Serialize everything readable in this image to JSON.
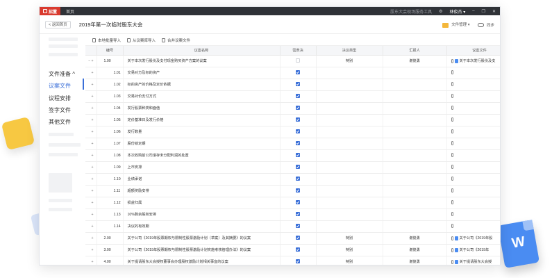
{
  "titlebar": {
    "logo": "招董",
    "home_tab": "首页",
    "system_name": "股东大会现场服务工具",
    "user_name": "林俊杰 ▾",
    "settings_glyph": "⚙",
    "minimize_glyph": "–",
    "restore_glyph": "❐",
    "close_glyph": "✕"
  },
  "header": {
    "back_label": "< 返回首页",
    "title": "2019年第一次临时股东大会",
    "file_manage": "文件管理",
    "file_manage_caret": "▾",
    "sync": "同步"
  },
  "sidebar": {
    "section": "文件准备",
    "section_caret": "^",
    "items": [
      "议案文件",
      "议程安排",
      "签字文件",
      "其他文件"
    ],
    "active_index": 0
  },
  "toolbar": {
    "import_local": "本地批量导入",
    "import_lib": "从议案库导入",
    "merge": "合并议案文件"
  },
  "table": {
    "headers": [
      "编号",
      "议案名称",
      "需表决",
      "决议类型",
      "汇报人",
      "议案文件"
    ],
    "rows": [
      {
        "exp": "− +",
        "num": "1.00",
        "name": "关于本次发行股份及支付现金购买资产方案的议案",
        "vote": false,
        "type": "特别",
        "reporter": "谢俊勇",
        "file": "关于本次发行股份及支",
        "sub": false,
        "clip": true,
        "doc": true
      },
      {
        "exp": "+",
        "num": "1.01",
        "name": "交易对方及标的资产",
        "vote": true,
        "type": "",
        "reporter": "",
        "file": "",
        "sub": true,
        "clip": true,
        "doc": false
      },
      {
        "exp": "+",
        "num": "1.02",
        "name": "标的资产的价格及定价依据",
        "vote": true,
        "type": "",
        "reporter": "",
        "file": "",
        "sub": true,
        "clip": true,
        "doc": false
      },
      {
        "exp": "+",
        "num": "1.03",
        "name": "交易对价支付方式",
        "vote": true,
        "type": "",
        "reporter": "",
        "file": "",
        "sub": true,
        "clip": true,
        "doc": false
      },
      {
        "exp": "+",
        "num": "1.04",
        "name": "发行股票种类和面值",
        "vote": true,
        "type": "",
        "reporter": "",
        "file": "",
        "sub": true,
        "clip": true,
        "doc": false
      },
      {
        "exp": "+",
        "num": "1.05",
        "name": "定价基准日及发行价格",
        "vote": true,
        "type": "",
        "reporter": "",
        "file": "",
        "sub": true,
        "clip": true,
        "doc": false
      },
      {
        "exp": "+",
        "num": "1.06",
        "name": "发行数量",
        "vote": true,
        "type": "",
        "reporter": "",
        "file": "",
        "sub": true,
        "clip": true,
        "doc": false
      },
      {
        "exp": "+",
        "num": "1.07",
        "name": "股份锁定期",
        "vote": true,
        "type": "",
        "reporter": "",
        "file": "",
        "sub": true,
        "clip": true,
        "doc": false
      },
      {
        "exp": "+",
        "num": "1.08",
        "name": "本次收购前公司滚存未分配利润的处置",
        "vote": true,
        "type": "",
        "reporter": "",
        "file": "",
        "sub": true,
        "clip": true,
        "doc": false
      },
      {
        "exp": "+",
        "num": "1.09",
        "name": "上市安排",
        "vote": true,
        "type": "",
        "reporter": "",
        "file": "",
        "sub": true,
        "clip": true,
        "doc": false
      },
      {
        "exp": "+",
        "num": "1.10",
        "name": "业绩承诺",
        "vote": true,
        "type": "",
        "reporter": "",
        "file": "",
        "sub": true,
        "clip": true,
        "doc": false
      },
      {
        "exp": "+",
        "num": "1.11",
        "name": "超额奖励安排",
        "vote": true,
        "type": "",
        "reporter": "",
        "file": "",
        "sub": true,
        "clip": true,
        "doc": false
      },
      {
        "exp": "+",
        "num": "1.12",
        "name": "损益归属",
        "vote": true,
        "type": "",
        "reporter": "",
        "file": "",
        "sub": true,
        "clip": true,
        "doc": false
      },
      {
        "exp": "+",
        "num": "1.13",
        "name": "10%剩余股权安排",
        "vote": true,
        "type": "",
        "reporter": "",
        "file": "",
        "sub": true,
        "clip": true,
        "doc": false
      },
      {
        "exp": "+",
        "num": "1.14",
        "name": "决议的有效期",
        "vote": true,
        "type": "",
        "reporter": "",
        "file": "",
        "sub": true,
        "clip": true,
        "doc": false
      },
      {
        "exp": "+",
        "num": "2.00",
        "name": "关于公司《2019年股票期权与限制性股票激励计划（草案）及其摘要》的议案",
        "vote": true,
        "type": "特别",
        "reporter": "谢俊勇",
        "file": "关于公司《2019年股",
        "sub": false,
        "clip": true,
        "doc": true
      },
      {
        "exp": "+",
        "num": "3.00",
        "name": "关于公司《2019年股票期权与限制性股票激励计划实施考核管理办法》的议案",
        "vote": true,
        "type": "特别",
        "reporter": "谢俊勇",
        "file": "关于公司《2019年",
        "sub": false,
        "clip": true,
        "doc": true
      },
      {
        "exp": "+",
        "num": "4.00",
        "name": "关于提请股东大会授权董事会办理股权激励计划相关事宜的议案",
        "vote": true,
        "type": "特别",
        "reporter": "谢俊勇",
        "file": "关于提请股东大会授",
        "sub": false,
        "clip": true,
        "doc": true
      }
    ]
  },
  "decor": {
    "doc_letter": "W"
  }
}
